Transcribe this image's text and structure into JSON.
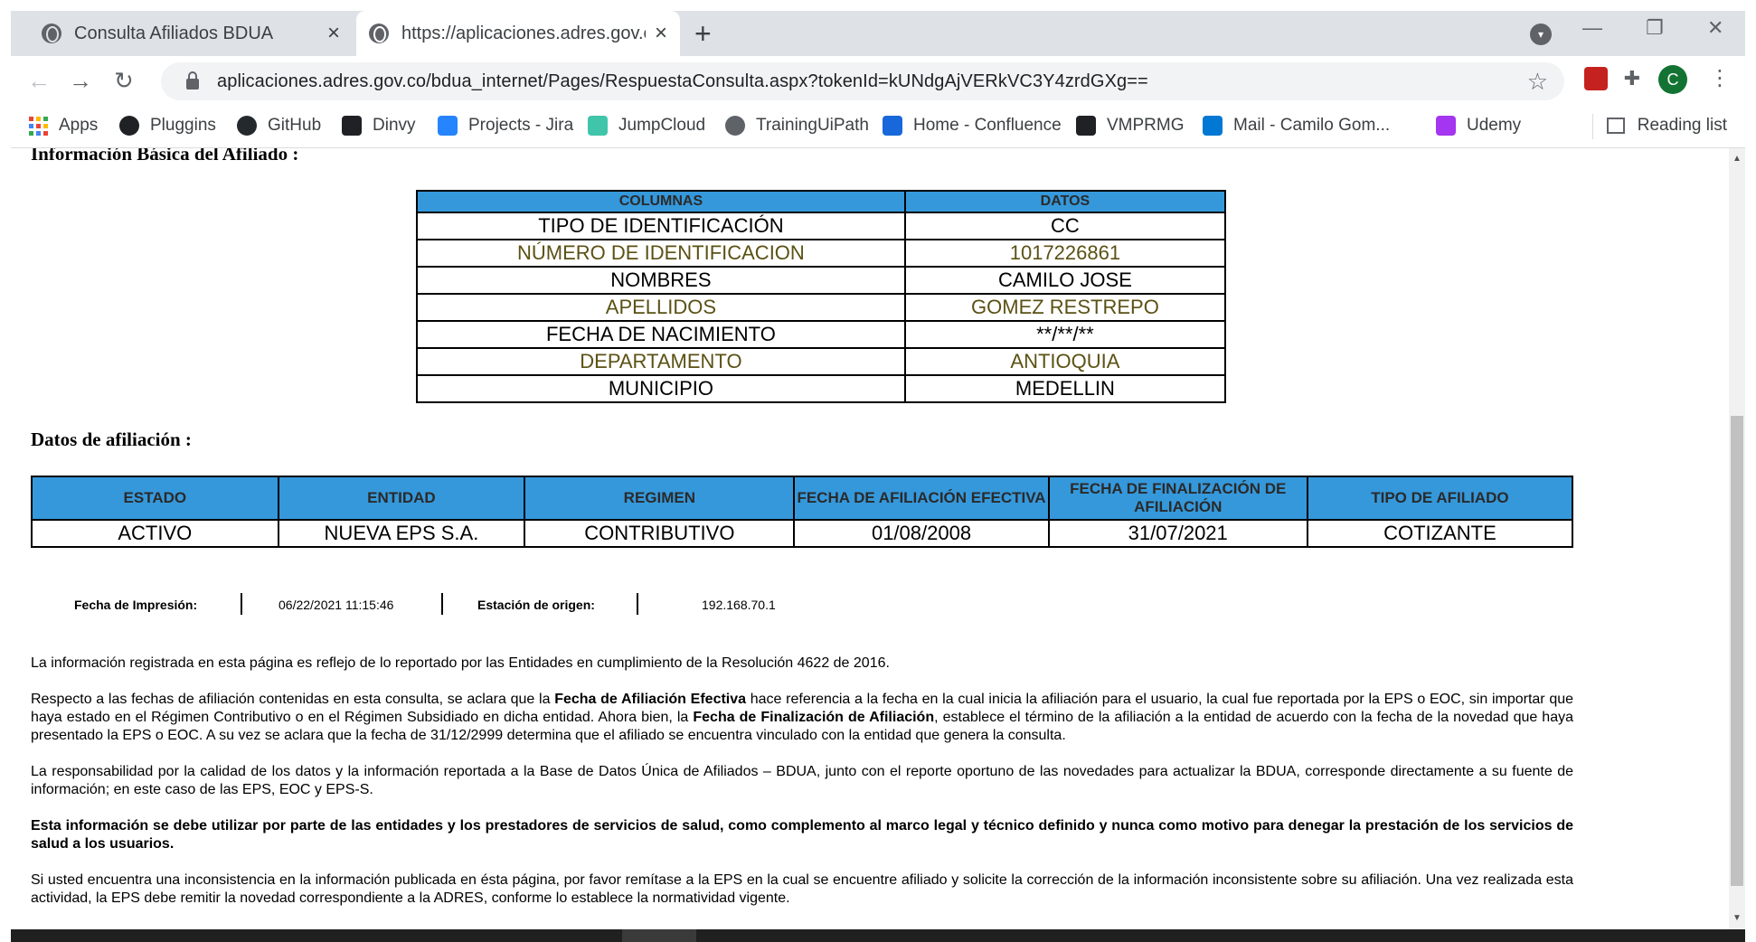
{
  "browser": {
    "tabs": [
      {
        "title": "Consulta Afiliados BDUA",
        "active": false
      },
      {
        "title": "https://aplicaciones.adres.gov.co/",
        "active": true
      }
    ],
    "new_tab": "+",
    "url": "aplicaciones.adres.gov.co/bdua_internet/Pages/RespuestaConsulta.aspx?tokenId=kUNdgAjVERkVC3Y4zrdGXg==",
    "profile_initial": "C",
    "bookmarks": [
      "Apps",
      "Pluggins",
      "GitHub",
      "Dinvy",
      "Projects - Jira",
      "JumpCloud",
      "TrainingUiPath",
      "Home - Confluence",
      "VMPRMG",
      "Mail - Camilo Gom...",
      "Udemy"
    ],
    "reading_list": "Reading list",
    "icons": {
      "back": "back-arrow-icon",
      "forward": "forward-arrow-icon",
      "reload": "reload-icon",
      "lock": "lock-icon",
      "star": "bookmark-star-icon",
      "extensions": "puzzle-icon",
      "menu": "kebab-menu-icon"
    }
  },
  "page": {
    "section1_title": "Información Básica del Afiliado :",
    "info_table": {
      "headers": [
        "COLUMNAS",
        "DATOS"
      ],
      "rows": [
        [
          "TIPO DE IDENTIFICACIÓN",
          "CC"
        ],
        [
          "NÚMERO DE IDENTIFICACION",
          "1017226861"
        ],
        [
          "NOMBRES",
          "CAMILO JOSE"
        ],
        [
          "APELLIDOS",
          "GOMEZ RESTREPO"
        ],
        [
          "FECHA DE NACIMIENTO",
          "**/**/**"
        ],
        [
          "DEPARTAMENTO",
          "ANTIOQUIA"
        ],
        [
          "MUNICIPIO",
          "MEDELLIN"
        ]
      ]
    },
    "section2_title": "Datos de afiliación :",
    "afil_table": {
      "headers": [
        "ESTADO",
        "ENTIDAD",
        "REGIMEN",
        "FECHA DE AFILIACIÓN EFECTIVA",
        "FECHA DE FINALIZACIÓN DE AFILIACIÓN",
        "TIPO DE AFILIADO"
      ],
      "row": [
        "ACTIVO",
        "NUEVA EPS S.A.",
        "CONTRIBUTIVO",
        "01/08/2008",
        "31/07/2021",
        "COTIZANTE"
      ]
    },
    "print_info": {
      "fecha_label": "Fecha de Impresión:",
      "fecha_value": "06/22/2021 11:15:46",
      "estacion_label": "Estación de origen:",
      "estacion_value": "192.168.70.1"
    },
    "legal": {
      "p1": "La información registrada en esta página es reflejo de lo reportado por las Entidades en cumplimiento de la Resolución 4622 de 2016.",
      "p2_a": "Respecto a las fechas de afiliación contenidas en esta consulta, se aclara que la ",
      "p2_b": "Fecha de Afiliación Efectiva",
      "p2_c": " hace referencia a la fecha en la cual inicia la afiliación para el usuario, la cual fue reportada por la EPS o EOC, sin importar que haya estado en el Régimen Contributivo o en el Régimen Subsidiado en dicha entidad. Ahora bien, la ",
      "p2_d": "Fecha de Finalización de Afiliación",
      "p2_e": ", establece el término de la afiliación a la entidad de acuerdo con la fecha de la novedad que haya presentado la EPS o EOC. A su vez se aclara que la fecha de 31/12/2999 determina que el afiliado se encuentra vinculado con la entidad que genera la consulta.",
      "p3": "La responsabilidad por la calidad de los datos y la información reportada a la Base de Datos Única de Afiliados – BDUA, junto con el reporte oportuno de las novedades para actualizar la BDUA, corresponde directamente a su fuente de información; en este caso de las EPS, EOC y EPS-S.",
      "p4": "Esta información se debe utilizar por parte de las entidades y los prestadores de servicios de salud, como complemento al marco legal y técnico definido y nunca como motivo para denegar la prestación de los servicios de salud a los usuarios.",
      "p5": "Si usted encuentra una inconsistencia en la información publicada en ésta página, por favor remítase a la EPS en la cual se encuentre afiliado y solicite la corrección de la información inconsistente sobre su afiliación. Una vez realizada esta actividad, la EPS debe remitir la novedad correspondiente a la ADRES, conforme lo establece la normatividad vigente."
    }
  },
  "colors": {
    "header_blue": "#3598db",
    "alt_row_text": "#5b5114",
    "chrome_bg": "#dee1e6"
  }
}
